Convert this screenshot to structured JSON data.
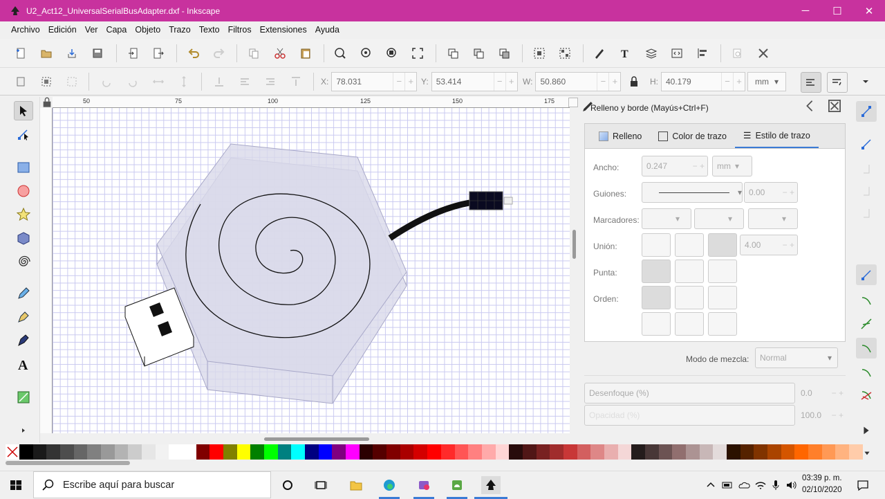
{
  "window": {
    "title": "U2_Act12_UniversalSerialBusAdapter.dxf - Inkscape",
    "minimize": "─",
    "maximize": "☐",
    "close": "✕"
  },
  "menu": [
    "Archivo",
    "Edición",
    "Ver",
    "Capa",
    "Objeto",
    "Trazo",
    "Texto",
    "Filtros",
    "Extensiones",
    "Ayuda"
  ],
  "coords": {
    "x_label": "X:",
    "x_value": "78.031",
    "y_label": "Y:",
    "y_value": "53.414",
    "w_label": "W:",
    "w_value": "50.860",
    "h_label": "H:",
    "h_value": "40.179",
    "unit": "mm"
  },
  "ruler": {
    "ticks": [
      "50",
      "75",
      "100",
      "125",
      "150",
      "175"
    ]
  },
  "panel": {
    "title": "Relleno y borde (Mayús+Ctrl+F)",
    "tabs": [
      {
        "label": "Relleno"
      },
      {
        "label": "Color de trazo"
      },
      {
        "label": "Estilo de trazo",
        "active": true
      }
    ],
    "width_label": "Ancho:",
    "width_value": "0.247",
    "width_unit": "mm",
    "dashes_label": "Guiones:",
    "dashes_value": "0.00",
    "markers_label": "Marcadores:",
    "join_label": "Unión:",
    "join_value": "4.00",
    "cap_label": "Punta:",
    "order_label": "Orden:",
    "blend_label": "Modo de mezcla:",
    "blend_value": "Normal",
    "blur_label": "Desenfoque (%)",
    "blur_value": "0.0",
    "opacity_label": "Opacidad (%)",
    "opacity_value": "100.0"
  },
  "taskbar": {
    "search_placeholder": "Escribe aquí para buscar",
    "time": "03:39 p. m.",
    "date": "02/10/2020"
  },
  "palette_colors": [
    "#000000",
    "#1a1a1a",
    "#333333",
    "#4d4d4d",
    "#666666",
    "#808080",
    "#999999",
    "#b3b3b3",
    "#cccccc",
    "#e6e6e6",
    "#f2f2f2",
    "#ffffff",
    "#ffffff",
    "#800000",
    "#ff0000",
    "#808000",
    "#ffff00",
    "#008000",
    "#00ff00",
    "#008080",
    "#00ffff",
    "#000080",
    "#0000ff",
    "#800080",
    "#ff00ff",
    "#2b0000",
    "#550000",
    "#800000",
    "#aa0000",
    "#d40000",
    "#ff0000",
    "#ff2a2a",
    "#ff5555",
    "#ff8080",
    "#ffaaaa",
    "#ffd5d5",
    "#280b0b",
    "#501616",
    "#782121",
    "#a02c2c",
    "#c83737",
    "#d35f5f",
    "#de8787",
    "#e9afaf",
    "#f4d7d7",
    "#241c1c",
    "#483737",
    "#6c5353",
    "#916f6f",
    "#ac9393",
    "#c8b7b7",
    "#e3dbdb",
    "#2b1100",
    "#552200",
    "#803300",
    "#aa4400",
    "#d45500",
    "#ff6600",
    "#ff7f2a",
    "#ff9955",
    "#ffb380",
    "#ffccaa"
  ]
}
